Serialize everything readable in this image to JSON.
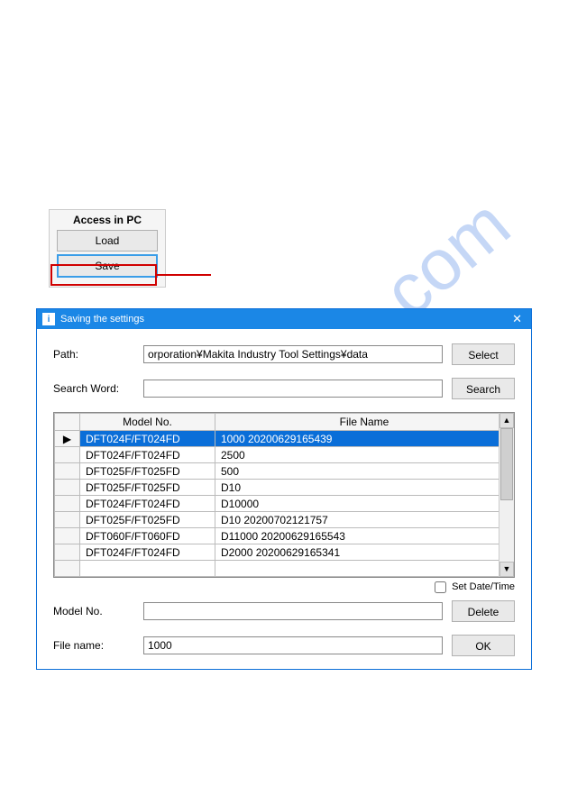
{
  "watermark": "manualshive.com",
  "access_panel": {
    "title": "Access in PC",
    "load_label": "Load",
    "save_label": "Save"
  },
  "dialog": {
    "title": "Saving the settings",
    "path_label": "Path:",
    "path_value": "orporation¥Makita Industry Tool Settings¥data",
    "select_label": "Select",
    "searchword_label": "Search Word:",
    "search_label": "Search",
    "grid": {
      "headers": {
        "model": "Model No.",
        "filename": "File Name"
      },
      "rows": [
        {
          "indicator": "▶",
          "model": "DFT024F/FT024FD",
          "filename": "1000 20200629165439",
          "selected": true
        },
        {
          "indicator": "",
          "model": "DFT024F/FT024FD",
          "filename": "2500",
          "selected": false
        },
        {
          "indicator": "",
          "model": "DFT025F/FT025FD",
          "filename": "500",
          "selected": false
        },
        {
          "indicator": "",
          "model": "DFT025F/FT025FD",
          "filename": "D10",
          "selected": false
        },
        {
          "indicator": "",
          "model": "DFT024F/FT024FD",
          "filename": "D10000",
          "selected": false
        },
        {
          "indicator": "",
          "model": "DFT025F/FT025FD",
          "filename": "D10 20200702121757",
          "selected": false
        },
        {
          "indicator": "",
          "model": "DFT060F/FT060FD",
          "filename": "D11000 20200629165543",
          "selected": false
        },
        {
          "indicator": "",
          "model": "DFT024F/FT024FD",
          "filename": "D2000 20200629165341",
          "selected": false
        }
      ]
    },
    "setdatetime_label": "Set Date/Time",
    "modelno_label": "Model No.",
    "delete_label": "Delete",
    "filename_label": "File name:",
    "filename_value": "1000",
    "ok_label": "OK"
  }
}
